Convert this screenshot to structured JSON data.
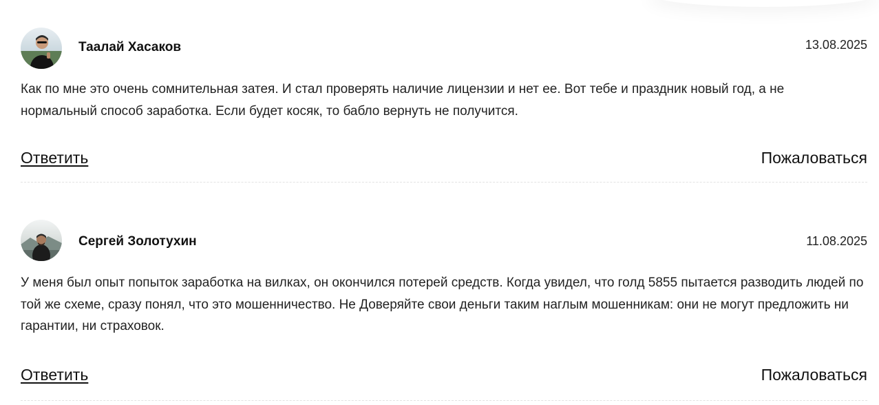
{
  "comments": [
    {
      "author": "Таалай Хасаков",
      "date": "13.08.2025",
      "text": "Как по мне это очень сомнительная затея. И стал проверять наличие лицензии и нет ее. Вот тебе и праздник новый год, а не нормальный способ заработка. Если будет косяк, то бабло вернуть не получится.",
      "reply_label": "Ответить",
      "report_label": "Пожаловаться"
    },
    {
      "author": "Сергей Золотухин",
      "date": "11.08.2025",
      "text": "У меня был опыт попыток заработка на вилках, он окончился потерей средств. Когда увидел, что голд 5855 пытается разводить людей по той же схеме, сразу понял, что это мошенничество. Не Доверяйте свои деньги таким наглым мошенникам: они не могут предложить ни гарантии, ни страховок.",
      "reply_label": "Ответить",
      "report_label": "Пожаловаться"
    }
  ]
}
